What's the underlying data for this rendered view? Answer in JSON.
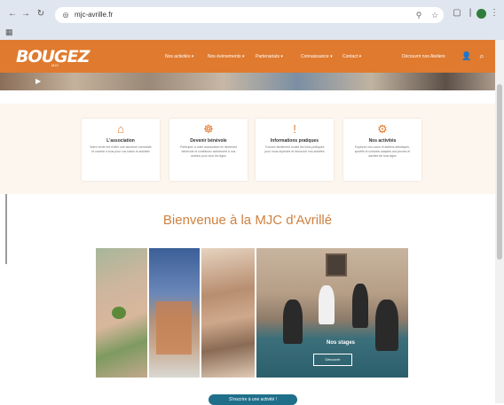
{
  "browser": {
    "url": "mjc-avrille.fr",
    "back_icon": "arrow-left-icon",
    "forward_icon": "arrow-right-icon",
    "reload_icon": "reload-icon",
    "bookmarks_icon": "grid-icon"
  },
  "site": {
    "logo": "BOUGEZ",
    "logo_sub": "MJC",
    "nav": [
      {
        "label": "Nos activités"
      },
      {
        "label": "Nos évènements"
      },
      {
        "label": "Partenariats"
      },
      {
        "label": "Connaissance"
      },
      {
        "label": "Contact"
      }
    ],
    "header_action": "Découvrir nos Ateliers"
  },
  "features": [
    {
      "icon": "home-icon",
      "title": "L'association",
      "text": "Notre envie est d'offrir une structure conviviale et ouverte à tous pour vos loisirs et activités"
    },
    {
      "icon": "people-icon",
      "title": "Devenir bénévole",
      "text": "Participez à notre association en devenant bénévole et contribuez activement à nos actions pour tous les âges"
    },
    {
      "icon": "exclamation-icon",
      "title": "Informations pratiques",
      "text": "Trouvez facilement toutes les infos pratiques pour nous rejoindre et découvrir nos activités"
    },
    {
      "icon": "gears-icon",
      "title": "Nos activités",
      "text": "Explorez nos cours et ateliers artistiques, sportifs et culturels adaptés aux jeunes et adultes de tous âges"
    }
  ],
  "welcome_title": "Bienvenue à la MJC d'Avrillé",
  "stages": {
    "title": "Nos stages",
    "button": "Découvrir"
  },
  "cta": "S'inscrire à une activité !",
  "colors": {
    "accent": "#e07a2e",
    "cta": "#1f6f8b",
    "welcome": "#d0813f"
  }
}
